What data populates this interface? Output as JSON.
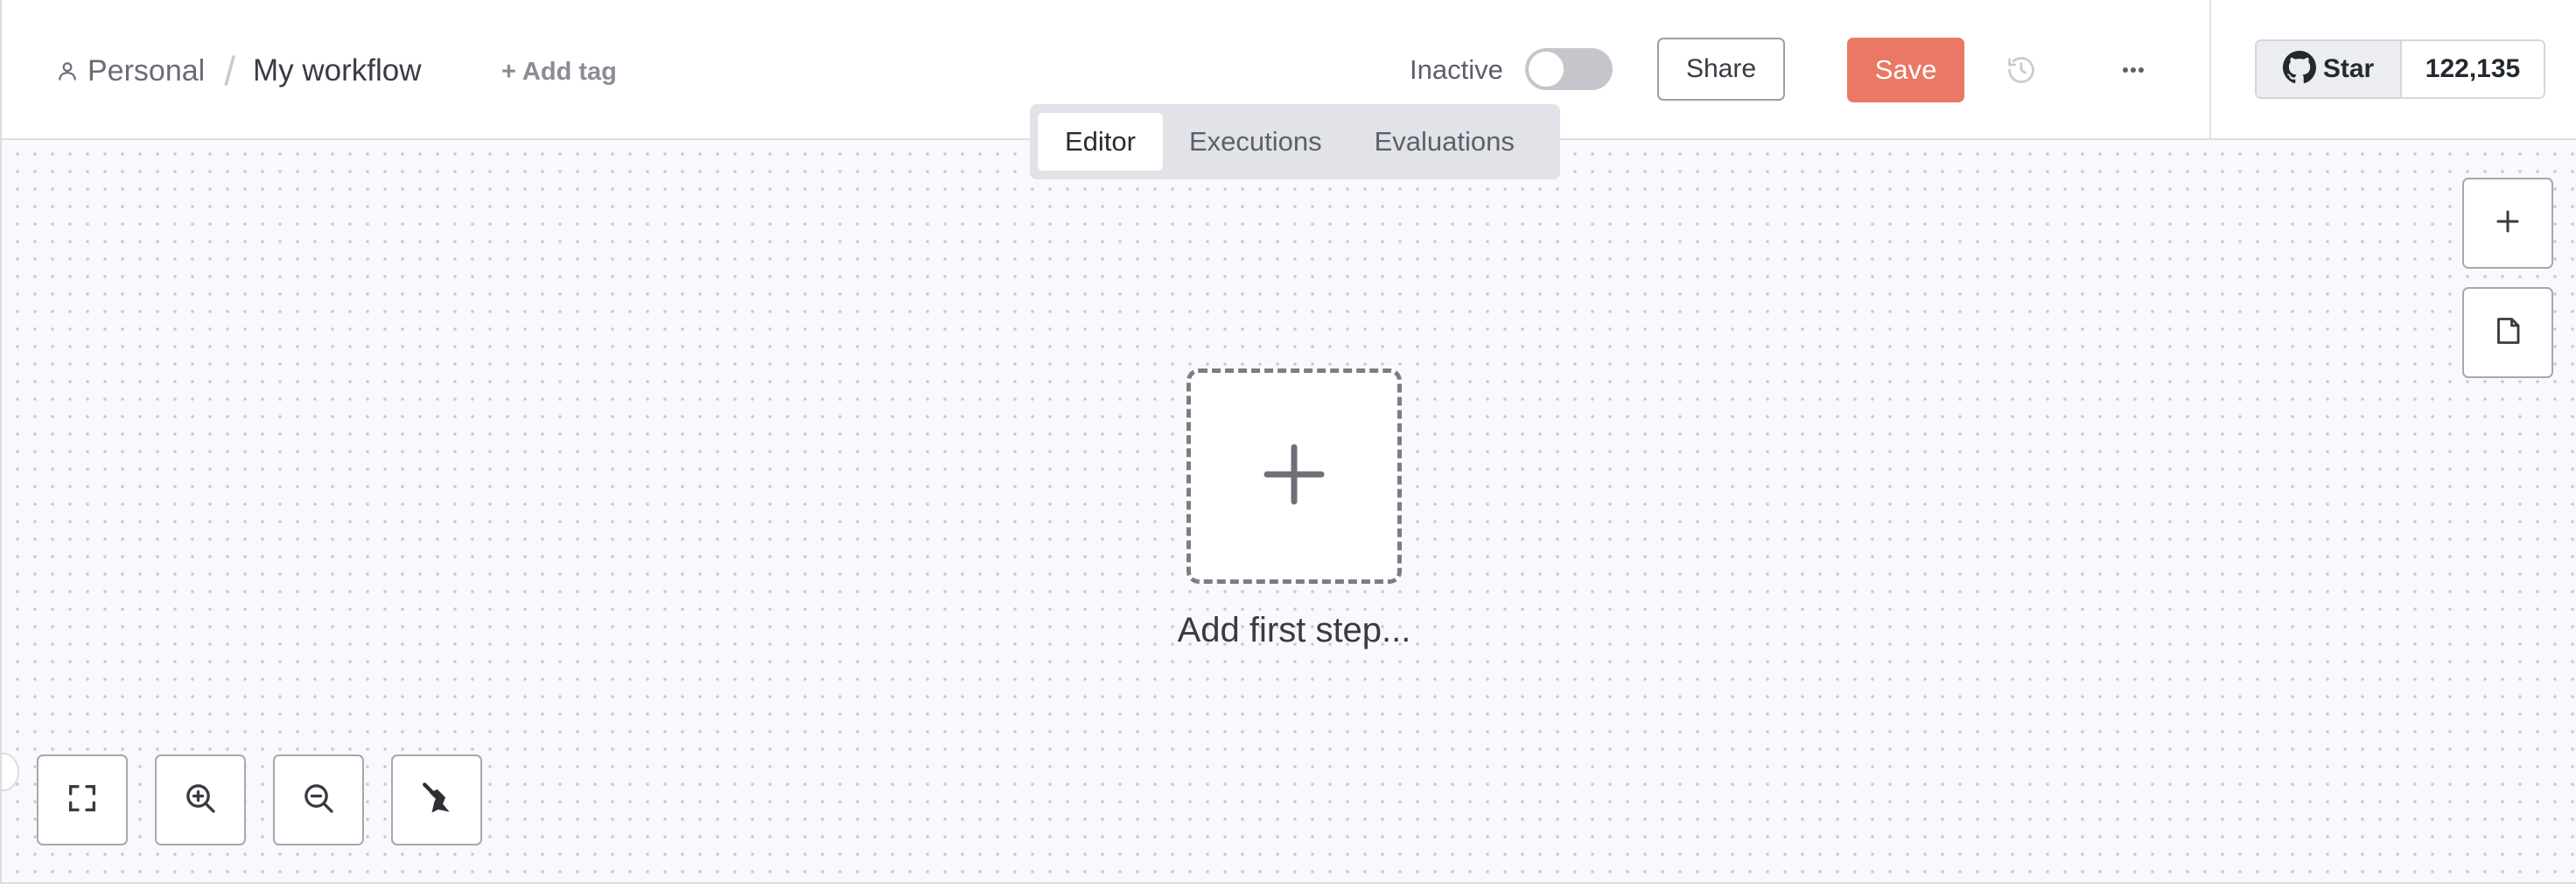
{
  "header": {
    "project_name": "Personal",
    "workflow_name": "My workflow",
    "add_tag_label": "+ Add tag",
    "status_label": "Inactive",
    "active": false,
    "share_label": "Share",
    "save_label": "Save",
    "icons": {
      "project": "user-icon",
      "history": "history-icon",
      "more": "ellipsis-icon"
    }
  },
  "github": {
    "star_label": "Star",
    "star_count": "122,135",
    "icon": "github-icon"
  },
  "tabs": [
    {
      "label": "Editor",
      "active": true
    },
    {
      "label": "Executions",
      "active": false
    },
    {
      "label": "Evaluations",
      "active": false
    }
  ],
  "canvas": {
    "add_first_step_label": "Add first step...",
    "right_tools": [
      "plus-icon",
      "sticky-note-icon"
    ],
    "bottom_tools": [
      "fit-view-icon",
      "zoom-in-icon",
      "zoom-out-icon",
      "tidy-up-icon"
    ]
  },
  "colors": {
    "save_button": "#ea7864",
    "canvas_background": "#f8f9fc",
    "toggle_off": "#c4c6cc"
  }
}
